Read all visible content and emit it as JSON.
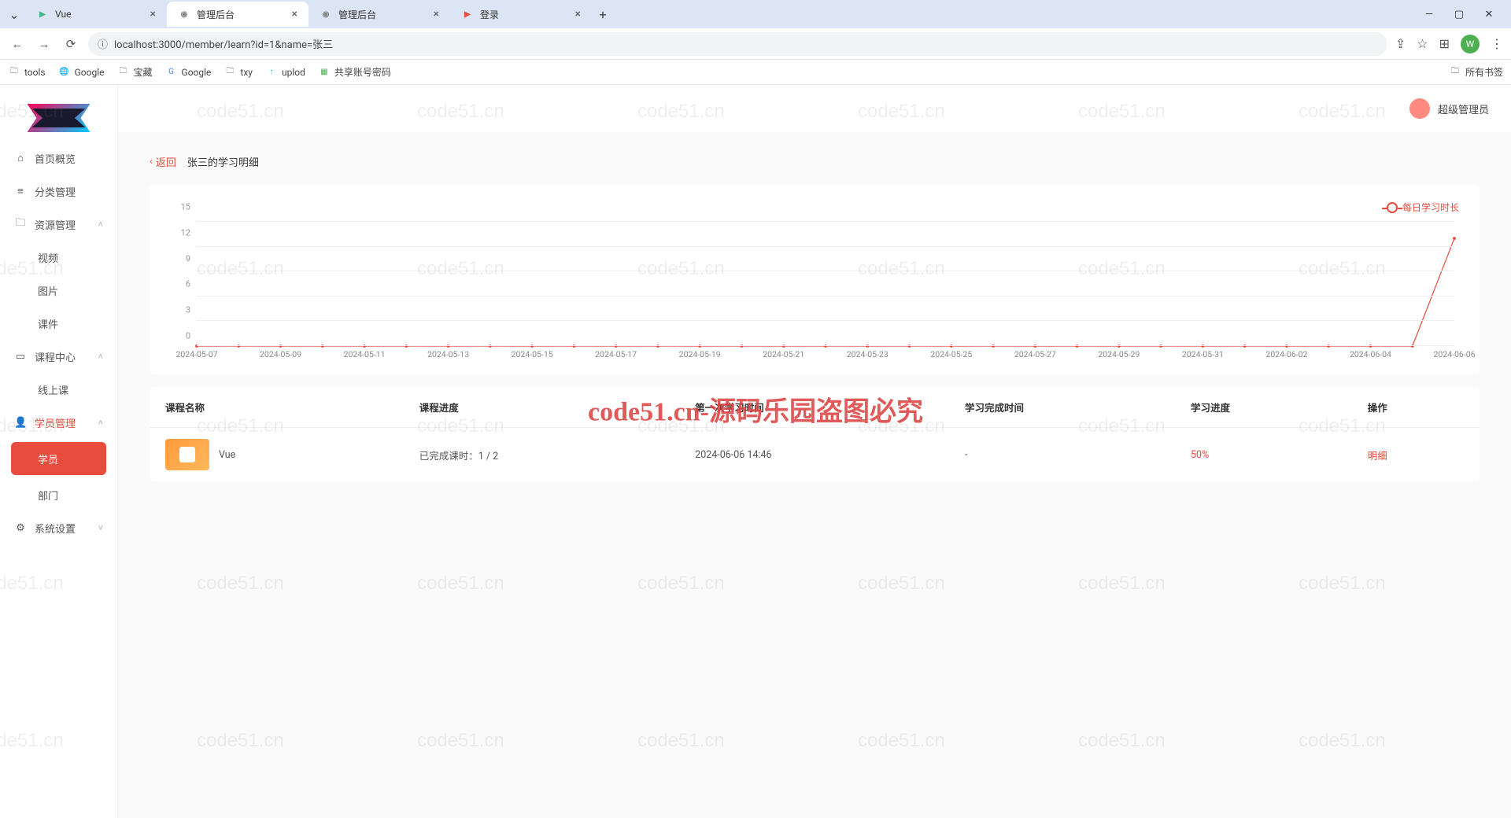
{
  "browser": {
    "tabs": [
      {
        "favicon_color": "#42b883",
        "favicon_text": "▶",
        "title": "Vue",
        "active": false
      },
      {
        "favicon_color": "#888",
        "favicon_text": "◉",
        "title": "管理后台",
        "active": true
      },
      {
        "favicon_color": "#888",
        "favicon_text": "◉",
        "title": "管理后台",
        "active": false
      },
      {
        "favicon_color": "#e74c3c",
        "favicon_text": "▶",
        "title": "登录",
        "active": false
      }
    ],
    "url": "localhost:3000/member/learn?id=1&name=张三",
    "window_controls": [
      "—",
      "▢",
      "✕"
    ],
    "addr_icons": {
      "back": "←",
      "forward": "→",
      "reload": "⟳",
      "secure": "ⓘ",
      "share": "⇪",
      "star": "☆",
      "ext": "⊞",
      "menu": "⋮",
      "profile": "W"
    },
    "bookmarks": [
      {
        "icon": "🗀",
        "label": "tools"
      },
      {
        "icon": "🌐",
        "label": "Google"
      },
      {
        "icon": "🗀",
        "label": "宝藏"
      },
      {
        "icon": "G",
        "label": "Google",
        "color": "#4285f4"
      },
      {
        "icon": "🗀",
        "label": "txy"
      },
      {
        "icon": "↑",
        "label": "uplod",
        "color": "#00bcd4"
      },
      {
        "icon": "▦",
        "label": "共享账号密码",
        "color": "#4caf50"
      }
    ],
    "bookmarks_right": {
      "icon": "🗀",
      "label": "所有书签"
    }
  },
  "header": {
    "username": "超级管理员"
  },
  "sidebar": {
    "items": [
      {
        "icon": "⌂",
        "label": "首页概览",
        "type": "item"
      },
      {
        "icon": "≡",
        "label": "分类管理",
        "type": "item"
      },
      {
        "icon": "🗀",
        "label": "资源管理",
        "type": "group",
        "expanded": true,
        "children": [
          {
            "label": "视频"
          },
          {
            "label": "图片"
          },
          {
            "label": "课件"
          }
        ]
      },
      {
        "icon": "▭",
        "label": "课程中心",
        "type": "group",
        "expanded": true,
        "children": [
          {
            "label": "线上课"
          }
        ]
      },
      {
        "icon": "👤",
        "label": "学员管理",
        "type": "group",
        "expanded": true,
        "active": true,
        "children": [
          {
            "label": "学员",
            "pill": true
          },
          {
            "label": "部门"
          }
        ]
      },
      {
        "icon": "⚙",
        "label": "系统设置",
        "type": "group",
        "expanded": false
      }
    ]
  },
  "breadcrumb": {
    "back_label": "返回",
    "title": "张三的学习明细"
  },
  "chart_data": {
    "type": "line",
    "legend": "每日学习时长",
    "ylim": [
      0,
      15
    ],
    "y_ticks": [
      0,
      3,
      6,
      9,
      12,
      15
    ],
    "x_labels": [
      "2024-05-07",
      "2024-05-09",
      "2024-05-11",
      "2024-05-13",
      "2024-05-15",
      "2024-05-17",
      "2024-05-19",
      "2024-05-21",
      "2024-05-23",
      "2024-05-25",
      "2024-05-27",
      "2024-05-29",
      "2024-05-31",
      "2024-06-02",
      "2024-06-04",
      "2024-06-06"
    ],
    "series": [
      {
        "name": "每日学习时长",
        "color": "#e74c3c",
        "values": [
          0,
          0,
          0,
          0,
          0,
          0,
          0,
          0,
          0,
          0,
          0,
          0,
          0,
          0,
          0,
          0,
          0,
          0,
          0,
          0,
          0,
          0,
          0,
          0,
          0,
          0,
          0,
          0,
          0,
          0,
          13
        ]
      }
    ]
  },
  "table": {
    "columns": [
      "课程名称",
      "课程进度",
      "第一次学习时间",
      "学习完成时间",
      "学习进度",
      "操作"
    ],
    "rows": [
      {
        "name": "Vue",
        "progress_text": "已完成课时：1 / 2",
        "first_time": "2024-06-06 14:46",
        "complete_time": "-",
        "percent": "50%",
        "action": "明细"
      }
    ]
  },
  "watermark": "code51.cn-源码乐园盗图必究",
  "wm_small": "code51.cn"
}
